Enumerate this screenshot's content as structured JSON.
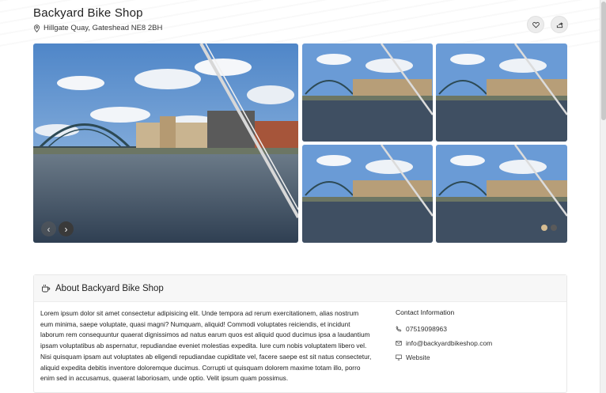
{
  "shop": {
    "name": "Backyard Bike Shop",
    "address": "Hillgate Quay, Gateshead NE8 2BH"
  },
  "icons": {
    "location": "map-pin-icon",
    "favorite": "heart-icon",
    "share": "share-icon",
    "prev": "chevron-left-icon",
    "next": "chevron-right-icon",
    "about": "coffee-cup-icon",
    "phone": "phone-icon",
    "email": "envelope-icon",
    "website": "monitor-icon"
  },
  "gallery": {
    "prev_glyph": "‹",
    "next_glyph": "›",
    "dots_total": 2,
    "dot_active_index": 0,
    "accent_color": "#d7bd92"
  },
  "about": {
    "heading": "About Backyard Bike Shop",
    "description": "Lorem ipsum dolor sit amet consectetur adipisicing elit. Unde tempora ad rerum exercitationem, alias nostrum eum minima, saepe voluptate, quasi magni? Numquam, aliquid! Commodi voluptates reiciendis, et incidunt laborum rem consequuntur quaerat dignissimos ad natus earum quos est aliquid quod ducimus ipsa a laudantium ipsam voluptatibus ab aspernatur, repudiandae eveniet molestias expedita. Iure cum nobis voluptatem libero vel. Nisi quisquam ipsam aut voluptates ab eligendi repudiandae cupiditate vel, facere saepe est sit natus consectetur, aliquid expedita debitis inventore doloremque ducimus. Corrupti ut quisquam dolorem maxime totam illo, porro enim sed in accusamus, quaerat laboriosam, unde optio. Velit ipsum quam possimus."
  },
  "contact": {
    "title": "Contact Information",
    "phone": "07519098963",
    "email": "info@backyardbikeshop.com",
    "website": "Website"
  }
}
